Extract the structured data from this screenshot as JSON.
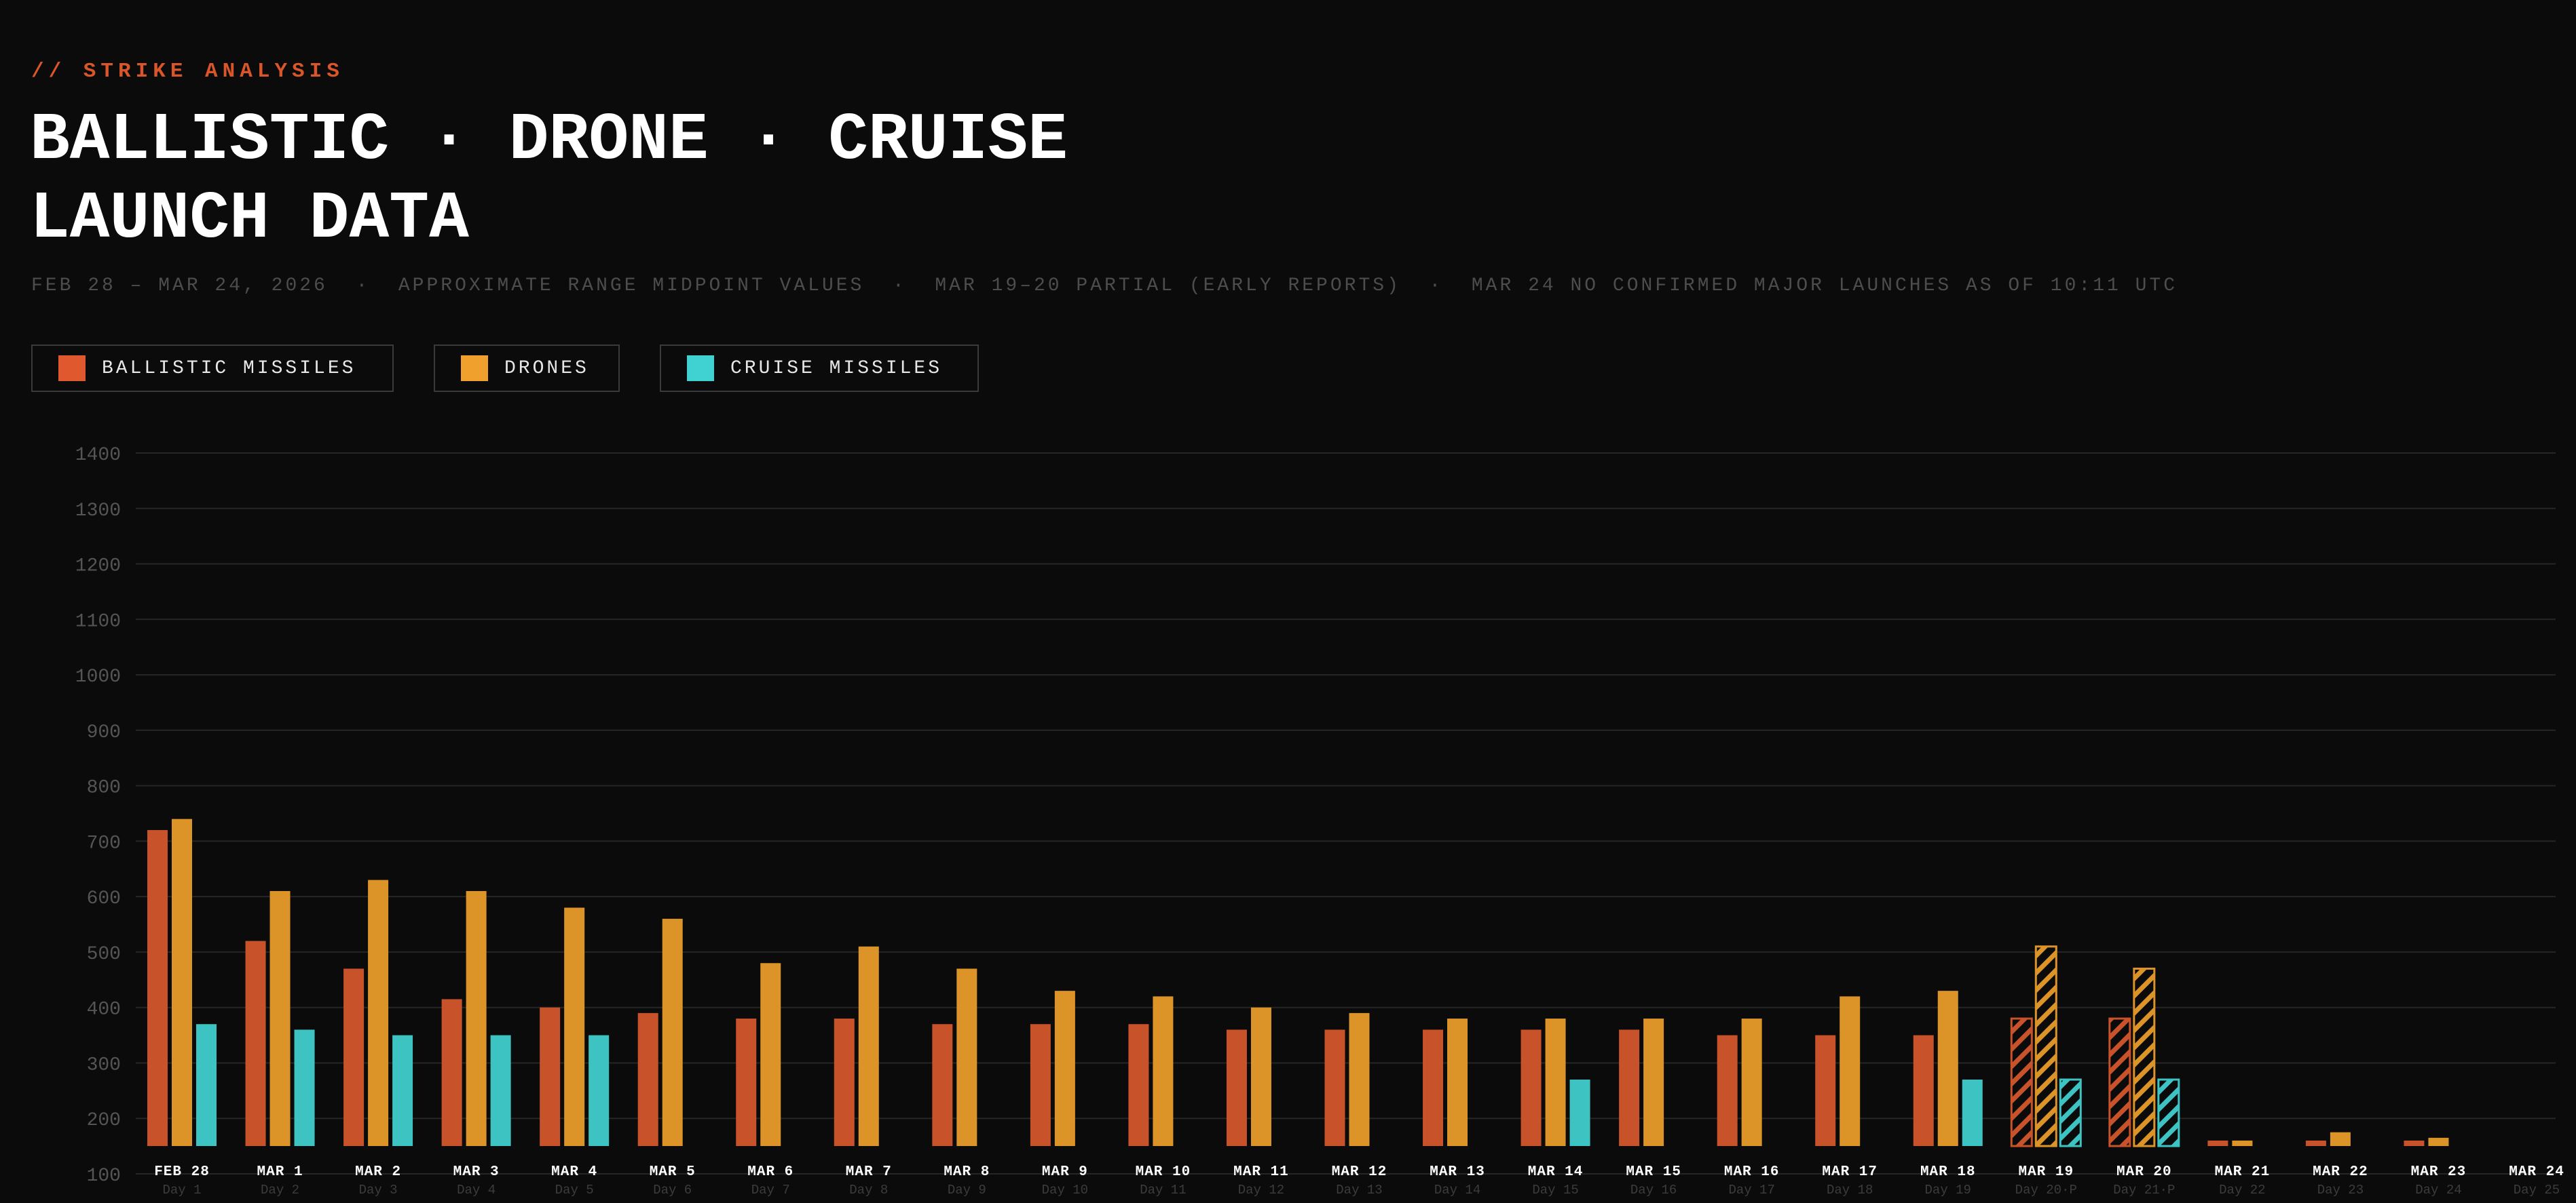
{
  "header": {
    "kicker": "// STRIKE ANALYSIS",
    "title_line1": "BALLISTIC · DRONE · CRUISE",
    "title_line2": "LAUNCH DATA",
    "subtitle": "FEB 28 – MAR 24, 2026  ·  APPROXIMATE RANGE MIDPOINT VALUES  ·  MAR 19–20 PARTIAL (EARLY REPORTS)  ·  MAR 24 NO CONFIRMED MAJOR LAUNCHES AS OF 10:11 UTC"
  },
  "legend": [
    {
      "label": "BALLISTIC MISSILES",
      "color": "#d9552a"
    },
    {
      "label": "DRONES",
      "color": "#f0a030"
    },
    {
      "label": "CRUISE MISSILES",
      "color": "#3ecfcf"
    }
  ],
  "chart_data": {
    "type": "bar",
    "title": "BALLISTIC · DRONE · CRUISE LAUNCH DATA",
    "categories": [
      "FEB 28",
      "MAR 1",
      "MAR 2",
      "MAR 3",
      "MAR 4",
      "MAR 5",
      "MAR 6",
      "MAR 7",
      "MAR 8",
      "MAR 9",
      "MAR 10",
      "MAR 11",
      "MAR 12",
      "MAR 13",
      "MAR 14",
      "MAR 15",
      "MAR 16",
      "MAR 17",
      "MAR 18",
      "MAR 19",
      "MAR 20",
      "MAR 21",
      "MAR 22",
      "MAR 23",
      "MAR 24"
    ],
    "day_labels": [
      "Day 1",
      "Day 2",
      "Day 3",
      "Day 4",
      "Day 5",
      "Day 6",
      "Day 7",
      "Day 8",
      "Day 9",
      "Day 10",
      "Day 11",
      "Day 12",
      "Day 13",
      "Day 14",
      "Day 15",
      "Day 16",
      "Day 17",
      "Day 18",
      "Day 19",
      "Day 20·P",
      "Day 21·P",
      "Day 22",
      "Day 23",
      "Day 24",
      "Day 25"
    ],
    "partial": [
      false,
      false,
      false,
      false,
      false,
      false,
      false,
      false,
      false,
      false,
      false,
      false,
      false,
      false,
      false,
      false,
      false,
      false,
      false,
      true,
      true,
      false,
      false,
      false,
      false
    ],
    "series": [
      {
        "name": "BALLISTIC MISSILES",
        "color": "#c8522a",
        "values": [
          720,
          520,
          470,
          415,
          400,
          390,
          380,
          380,
          370,
          370,
          370,
          360,
          360,
          360,
          360,
          360,
          350,
          350,
          350,
          380,
          380,
          160,
          160,
          160,
          null
        ]
      },
      {
        "name": "DRONES",
        "color": "#dc9428",
        "values": [
          740,
          610,
          630,
          610,
          580,
          560,
          480,
          510,
          470,
          430,
          420,
          400,
          390,
          380,
          380,
          380,
          380,
          420,
          430,
          510,
          470,
          160,
          175,
          165,
          null
        ]
      },
      {
        "name": "CRUISE MISSILES",
        "color": "#3ec3c3",
        "values": [
          370,
          360,
          350,
          350,
          350,
          null,
          null,
          null,
          null,
          null,
          null,
          null,
          null,
          null,
          270,
          null,
          null,
          null,
          270,
          270,
          270,
          null,
          null,
          null,
          null
        ]
      }
    ],
    "yticks": [
      100,
      200,
      300,
      400,
      500,
      600,
      700,
      800,
      900,
      1000,
      1100,
      1200,
      1300,
      1400
    ],
    "ylim": [
      100,
      1450
    ],
    "grid": true
  }
}
